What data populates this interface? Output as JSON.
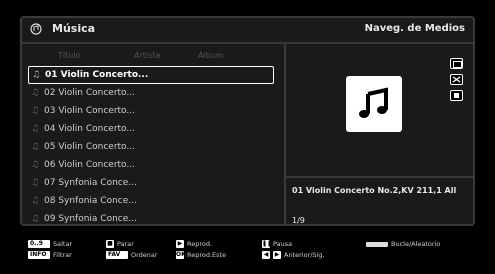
{
  "header": {
    "title": "Música",
    "right_label": "Naveg. de Medios"
  },
  "columns": [
    "Título",
    "Artista",
    "Álbum"
  ],
  "tracks": [
    "01 Violin Concerto...",
    "02 Violin Concerto...",
    "03 Violin Concerto...",
    "04 Violin Concerto...",
    "05 Violin Concerto...",
    "06 Violin Concerto...",
    "07 Synfonia Conce...",
    "08 Synfonia Conce...",
    "09 Synfonia Conce..."
  ],
  "selected_index": 0,
  "info": {
    "now_playing": "01 Violin Concerto No.2,KV 211,1 All",
    "counter": "1/9"
  },
  "footer": {
    "skip_key": "0..9",
    "skip_label": "Saltar",
    "info_key": "INFO",
    "filter_label": "Filtrar",
    "stop_label": "Parar",
    "fav_key": "FAV",
    "sort_label": "Ordenar",
    "play_label": "Reprod.",
    "ok_key": "OK",
    "play_this_label": "Reprod.Este",
    "pause_label": "Pausa",
    "prevnext_label": "Anterior/Sig.",
    "loop_label": "Bucle/Aleatorio"
  }
}
